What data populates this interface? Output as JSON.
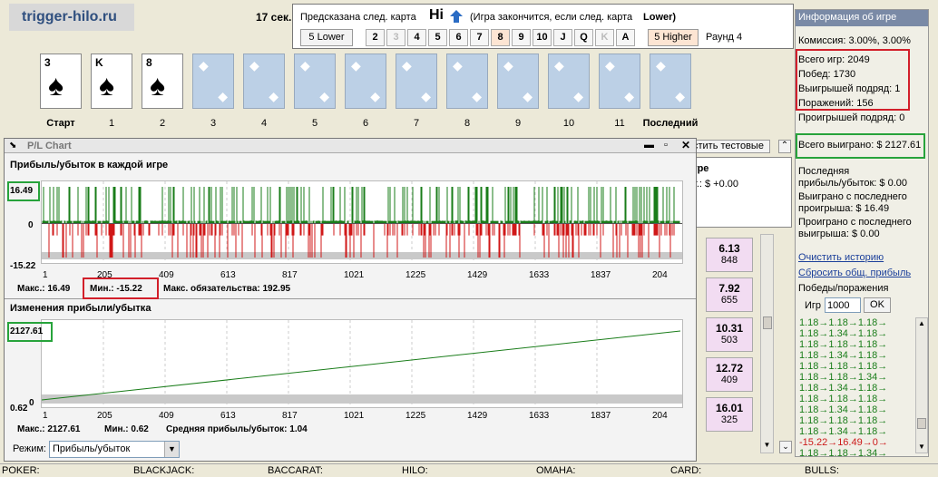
{
  "header": {
    "logo": "trigger-hilo.ru",
    "timer": "17 сек."
  },
  "prediction": {
    "label": "Предсказана след. карта",
    "value": "Hi",
    "note": "(Игра закончится, если след. карта",
    "lower": "Lower)",
    "lower_btn": "5 Lower",
    "higher_btn": "5 Higher",
    "round": "Раунд 4",
    "ranks": [
      "2",
      "3",
      "4",
      "5",
      "6",
      "7",
      "8",
      "9",
      "10",
      "J",
      "Q",
      "K",
      "A"
    ]
  },
  "cards": [
    {
      "rank": "3",
      "label": "Старт"
    },
    {
      "rank": "K",
      "label": "1"
    },
    {
      "rank": "8",
      "label": "2"
    },
    {
      "label": "3"
    },
    {
      "label": "4"
    },
    {
      "label": "5"
    },
    {
      "label": "6"
    },
    {
      "label": "7"
    },
    {
      "label": "8"
    },
    {
      "label": "9"
    },
    {
      "label": "10"
    },
    {
      "label": "11"
    },
    {
      "label": "Последний"
    }
  ],
  "right": {
    "title": "Информация об игре",
    "commission": "Комиссия: 3.00%, 3.00%",
    "total_games": "Всего игр: 2049",
    "wins": "Побед: 1730",
    "win_streak": "Выигрышей подряд: 1",
    "losses": "Поражений: 156",
    "loss_streak": "Проигрышей подряд: 0",
    "total_won": "Всего выиграно: $ 2127.61",
    "last_pl_1": "Последняя",
    "last_pl_2": "прибыль/убыток: $ 0.00",
    "won_since_1": "Выиграно с последнего",
    "won_since_2": "проигрыша: $ 16.49",
    "lost_since_1": "Проиграно с последнего",
    "lost_since_2": "выигрыша: $ 0.00",
    "clear_history": "Очистить историю",
    "reset_profit": "Сбросить общ. прибыль",
    "wl_label": "Победы/поражения",
    "games_label": "Игр",
    "games_value": "1000",
    "ok": "OK",
    "seq": [
      "1.18→1.18→1.18→",
      "1.18→1.34→1.18→",
      "1.18→1.18→1.18→",
      "1.18→1.34→1.18→",
      "1.18→1.18→1.18→",
      "1.18→1.18→1.34→",
      "1.18→1.34→1.18→",
      "1.18→1.18→1.18→",
      "1.18→1.34→1.18→",
      "1.18→1.18→1.18→",
      "1.18→1.34→1.18→",
      "-15.22→16.49→0→",
      "1.18→1.18→1.34→"
    ]
  },
  "middle": {
    "test_btn": "стить тестовые",
    "box_line1": "гре",
    "box_line2": "т.: $ +0.00",
    "cells": [
      {
        "v": "6.13",
        "n": "848"
      },
      {
        "v": "7.92",
        "n": "655"
      },
      {
        "v": "10.31",
        "n": "503"
      },
      {
        "v": "12.72",
        "n": "409"
      },
      {
        "v": "16.01",
        "n": "325"
      }
    ]
  },
  "chart_window": {
    "title": "P/L Chart",
    "mode_label": "Режим:",
    "mode_value": "Прибыль/убыток"
  },
  "chart_data": [
    {
      "type": "bar",
      "title": "Прибыль/убыток в каждой игре",
      "ylim": [
        -15.22,
        16.49
      ],
      "y_top_label": "16.49",
      "y_zero_label": "0",
      "y_bottom_label": "-15.22",
      "xticks": [
        "1",
        "205",
        "409",
        "613",
        "817",
        "1021",
        "1225",
        "1429",
        "1633",
        "1837",
        "204"
      ],
      "stats": {
        "max": "Макс.: 16.49",
        "min": "Мин.: -15.22",
        "liability": "Макс. обязательства: 192.95"
      }
    },
    {
      "type": "line",
      "title": "Изменения прибыли/убытка",
      "ylim": [
        0.62,
        2127.61
      ],
      "y_top_label": "2127.61",
      "y_bottom_label": "0.62",
      "y_zero_label": "0",
      "xticks": [
        "1",
        "205",
        "409",
        "613",
        "817",
        "1021",
        "1225",
        "1429",
        "1633",
        "1837",
        "204"
      ],
      "x": [
        1,
        2049
      ],
      "y": [
        0.62,
        2127.61
      ],
      "stats": {
        "max": "Макс.: 2127.61",
        "min": "Мин.: 0.62",
        "avg": "Средняя прибыль/убыток: 1.04"
      }
    }
  ],
  "status": [
    "POKER:",
    "BLACKJACK:",
    "BACCARAT:",
    "HILO:",
    "OMAHA:",
    "CARD:",
    "BULLS:"
  ],
  "colors": {
    "win": "#1a7d1a",
    "loss": "#d01818",
    "highlight_red": "#d21f2a",
    "highlight_green": "#27a33b"
  }
}
